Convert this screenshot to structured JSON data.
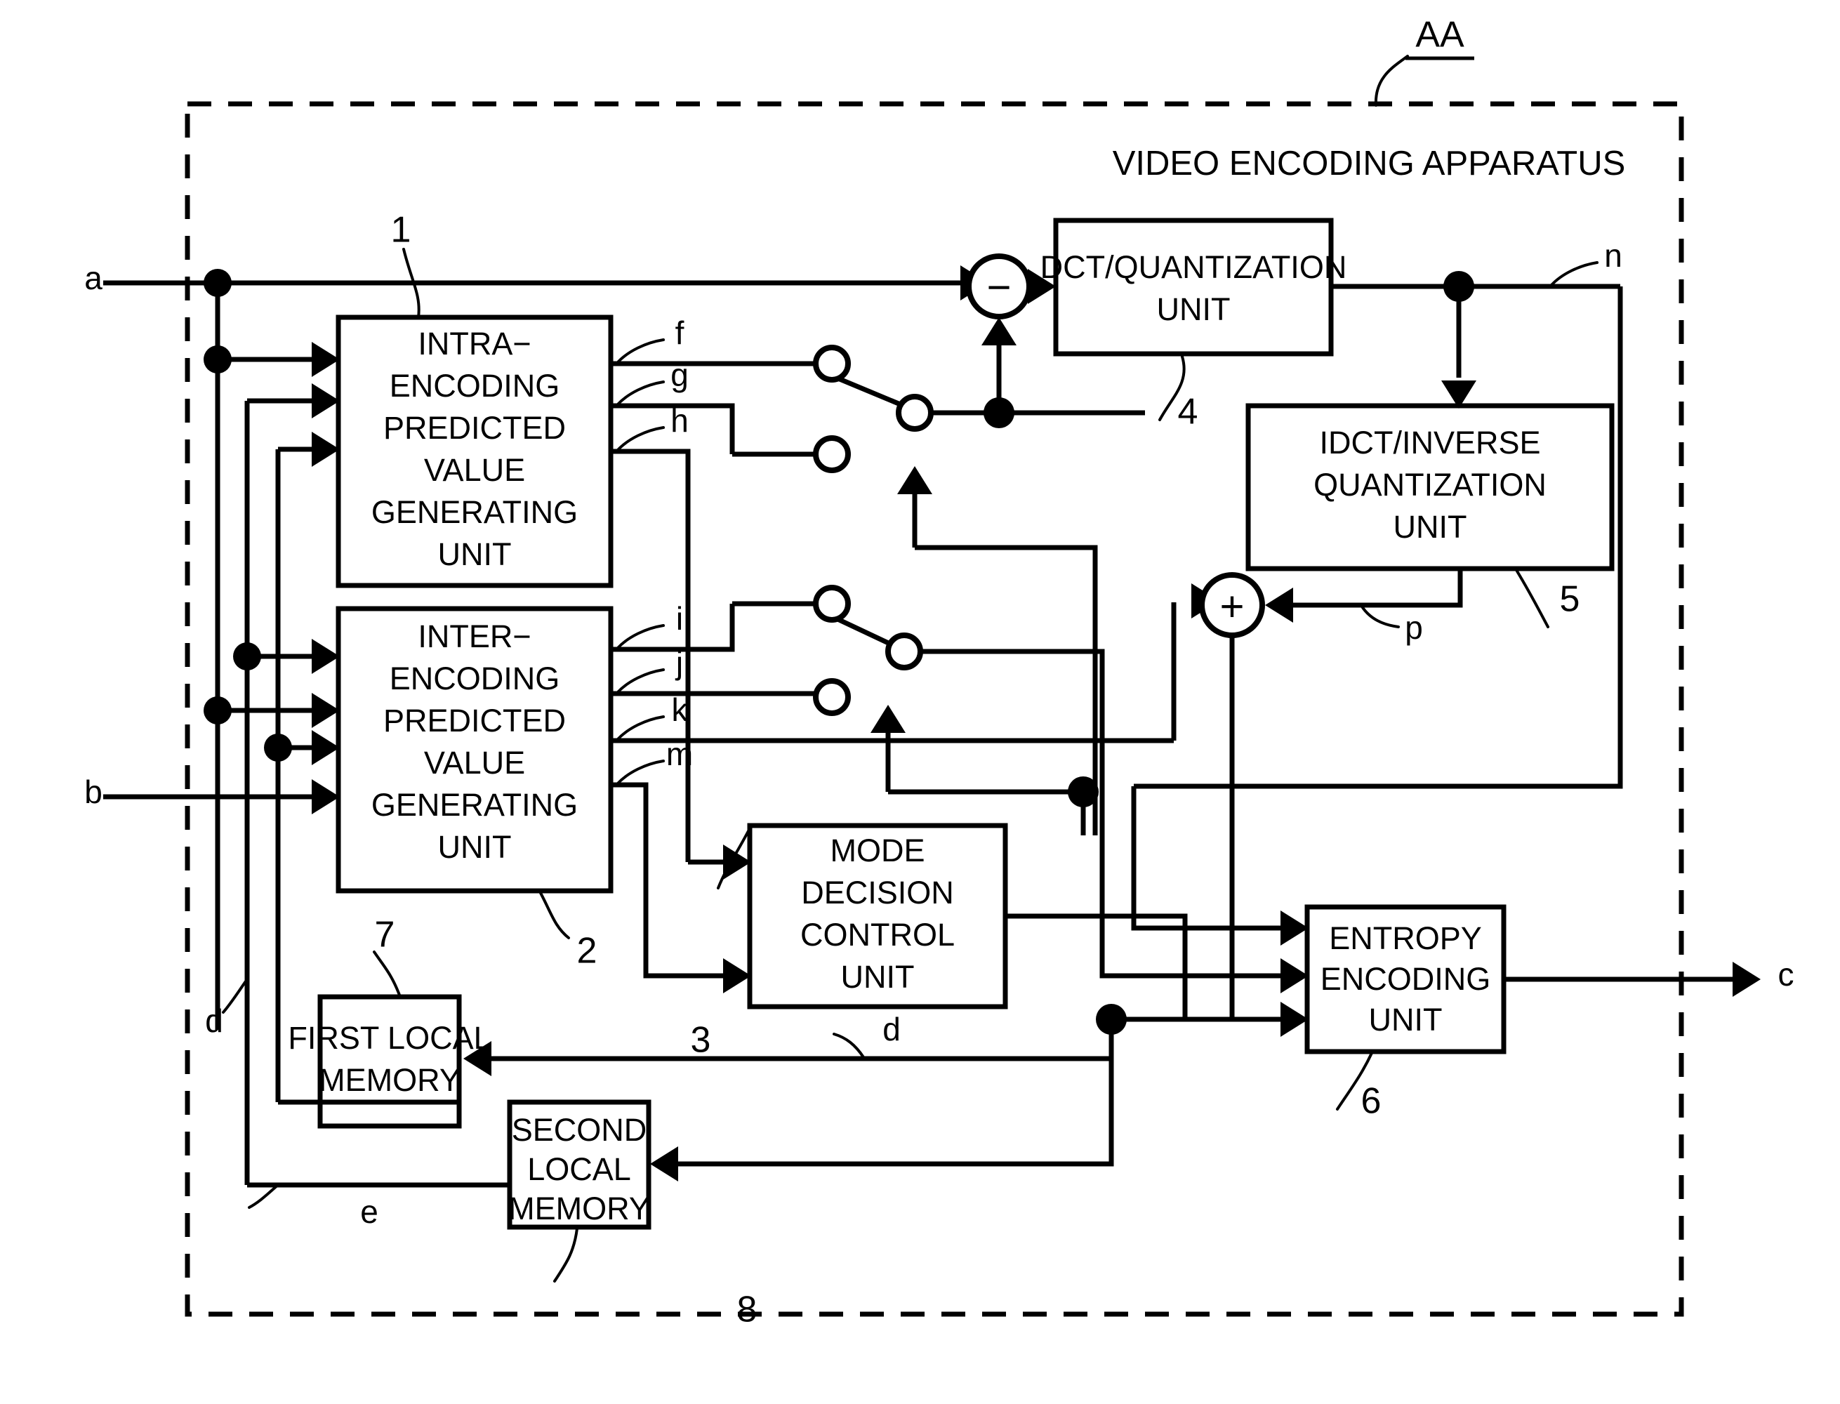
{
  "figure": {
    "apparatus_tag": "AA",
    "apparatus_title": "VIDEO ENCODING APPARATUS"
  },
  "blocks": [
    {
      "id": "intra",
      "label_lines": [
        "INTRA−",
        "ENCODING",
        "PREDICTED",
        "VALUE",
        "GENERATING",
        "UNIT"
      ],
      "ref": "1"
    },
    {
      "id": "inter",
      "label_lines": [
        "INTER−",
        "ENCODING",
        "PREDICTED",
        "VALUE",
        "GENERATING",
        "UNIT"
      ],
      "ref": "2"
    },
    {
      "id": "mode",
      "label_lines": [
        "MODE",
        "DECISION",
        "CONTROL",
        "UNIT"
      ],
      "ref": "3"
    },
    {
      "id": "dct",
      "label_lines": [
        "DCT/QUANTIZATION",
        "UNIT"
      ],
      "ref": "4"
    },
    {
      "id": "idct",
      "label_lines": [
        "IDCT/INVERSE",
        "QUANTIZATION",
        "UNIT"
      ],
      "ref": "5"
    },
    {
      "id": "entropy",
      "label_lines": [
        "ENTROPY",
        "ENCODING",
        "UNIT"
      ],
      "ref": "6"
    },
    {
      "id": "mem1",
      "label_lines": [
        "FIRST LOCAL",
        "MEMORY"
      ],
      "ref": "7"
    },
    {
      "id": "mem2",
      "label_lines": [
        "SECOND",
        "LOCAL",
        "MEMORY"
      ],
      "ref": "8"
    }
  ],
  "signals": {
    "a": "a",
    "b": "b",
    "c": "c",
    "d_left": "d",
    "d_mid": "d",
    "e": "e",
    "f": "f",
    "g": "g",
    "h": "h",
    "i": "i",
    "j": "j",
    "k": "k",
    "m": "m",
    "n": "n",
    "p": "p"
  },
  "operators": {
    "subtract": "−",
    "add": "+"
  },
  "refs": {
    "n1": "1",
    "n2": "2",
    "n3": "3",
    "n4": "4",
    "n5": "5",
    "n6": "6",
    "n7": "7",
    "n8": "8"
  },
  "colors": {
    "ink": "#000000",
    "paper": "#ffffff"
  }
}
